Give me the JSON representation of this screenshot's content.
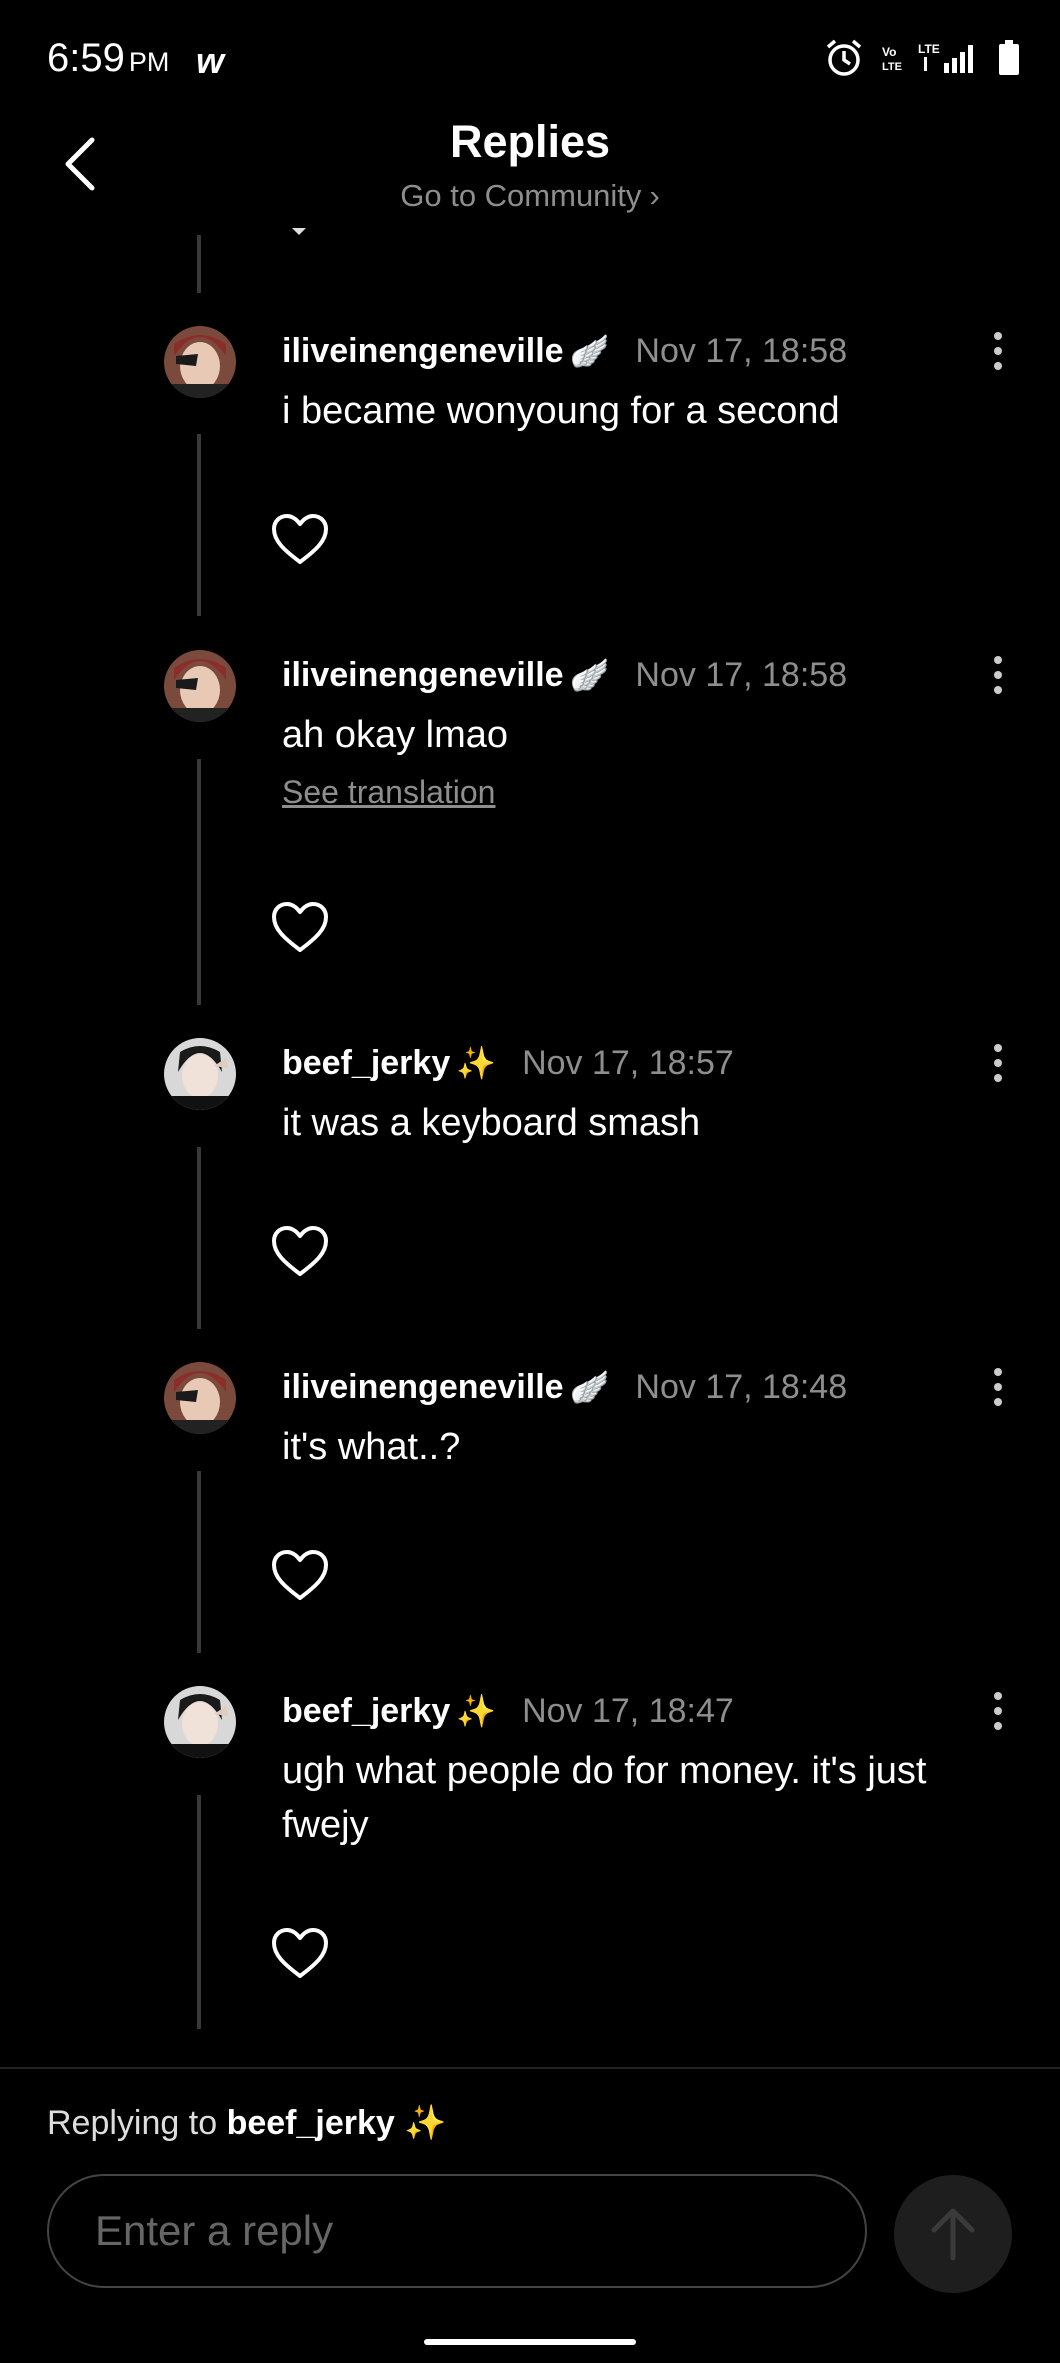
{
  "status_bar": {
    "time": "6:59",
    "ampm": "PM",
    "app_glyph": "w",
    "icons": [
      "alarm-icon",
      "volte-icon",
      "lte-icon",
      "signal-icon",
      "battery-icon"
    ]
  },
  "header": {
    "title": "Replies",
    "subtitle": "Go to Community",
    "subtitle_chevron": "›"
  },
  "comments": [
    {
      "username": "iliveinengeneville",
      "decoration": "🪽",
      "time": "Nov 17, 18:58",
      "text": "i became wonyoung for a second",
      "translation": ""
    },
    {
      "username": "iliveinengeneville",
      "decoration": "🪽",
      "time": "Nov 17, 18:58",
      "text": "ah okay lmao",
      "translation": "See translation"
    },
    {
      "username": "beef_jerky",
      "decoration": "✨",
      "time": "Nov 17, 18:57",
      "text": "it was a keyboard smash",
      "translation": ""
    },
    {
      "username": "iliveinengeneville",
      "decoration": "🪽",
      "time": "Nov 17, 18:48",
      "text": "it's what..?",
      "translation": ""
    },
    {
      "username": "beef_jerky",
      "decoration": "✨",
      "time": "Nov 17, 18:47",
      "text": "ugh what people do for money. it's just fwejy",
      "translation": ""
    }
  ],
  "composer": {
    "replying_prefix": "Replying to",
    "replying_user": "beef_jerky ✨",
    "placeholder": "Enter a reply"
  },
  "colors": {
    "background": "#000000",
    "text": "#ffffff",
    "muted": "#8e8e8e",
    "thread_line": "#3a3a3a"
  }
}
